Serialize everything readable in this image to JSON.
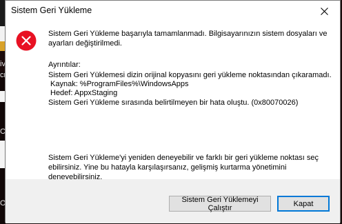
{
  "window": {
    "title": "Sistem Geri Yükleme"
  },
  "message": {
    "main_line1": "Sistem Geri Yükleme başarıyla tamamlanmadı. Bilgisayarınızın sistem dosyaları ve",
    "main_line2": "ayarları değiştirilmedi.",
    "details_heading": "Ayrıntılar:",
    "detail_line1": "Sistem Geri Yüklemesi dizin orijinal kopyasını geri yükleme noktasından çıkaramadı.",
    "detail_source": "Kaynak: %ProgramFiles%\\WindowsApps",
    "detail_target": "Hedef: AppxStaging",
    "detail_error": "Sistem Geri Yükleme sırasında belirtilmeyen bir hata oluştu. (0x80070026)",
    "advice_line1": "Sistem Geri Yükleme'yi yeniden deneyebilir ve farklı bir geri yükleme noktası seç",
    "advice_line2": "ebilirsiniz. Yine bu hatayla karşılaşırsanız, gelişmiş kurtarma yönetimini",
    "advice_line3": "deneyebilirsiniz."
  },
  "buttons": {
    "run_label": "Sistem Geri Yüklemeyi Çalıştır",
    "cancel_label": "Kapat"
  },
  "background_letters": [
    "iv",
    "cr",
    "CI",
    "Ol"
  ],
  "colors": {
    "error_red": "#e81123",
    "accent": "#0078d7"
  }
}
